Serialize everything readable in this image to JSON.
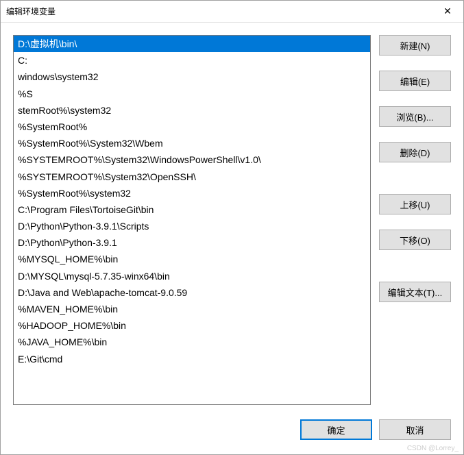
{
  "window": {
    "title": "编辑环境变量"
  },
  "list": {
    "selectedIndex": 0,
    "items": [
      "D:\\虚拟机\\bin\\",
      "C:",
      "windows\\system32",
      "%S",
      "stemRoot%\\system32",
      "%SystemRoot%",
      "%SystemRoot%\\System32\\Wbem",
      "%SYSTEMROOT%\\System32\\WindowsPowerShell\\v1.0\\",
      "%SYSTEMROOT%\\System32\\OpenSSH\\",
      "%SystemRoot%\\system32",
      "C:\\Program Files\\TortoiseGit\\bin",
      "D:\\Python\\Python-3.9.1\\Scripts",
      "D:\\Python\\Python-3.9.1",
      "%MYSQL_HOME%\\bin",
      "D:\\MYSQL\\mysql-5.7.35-winx64\\bin",
      "D:\\Java and Web\\apache-tomcat-9.0.59",
      "%MAVEN_HOME%\\bin",
      "%HADOOP_HOME%\\bin",
      "%JAVA_HOME%\\bin",
      "E:\\Git\\cmd"
    ]
  },
  "buttons": {
    "new": "新建(N)",
    "edit": "编辑(E)",
    "browse": "浏览(B)...",
    "delete": "删除(D)",
    "moveUp": "上移(U)",
    "moveDown": "下移(O)",
    "editText": "编辑文本(T)...",
    "ok": "确定",
    "cancel": "取消"
  },
  "watermark": "CSDN @Lorrey_"
}
